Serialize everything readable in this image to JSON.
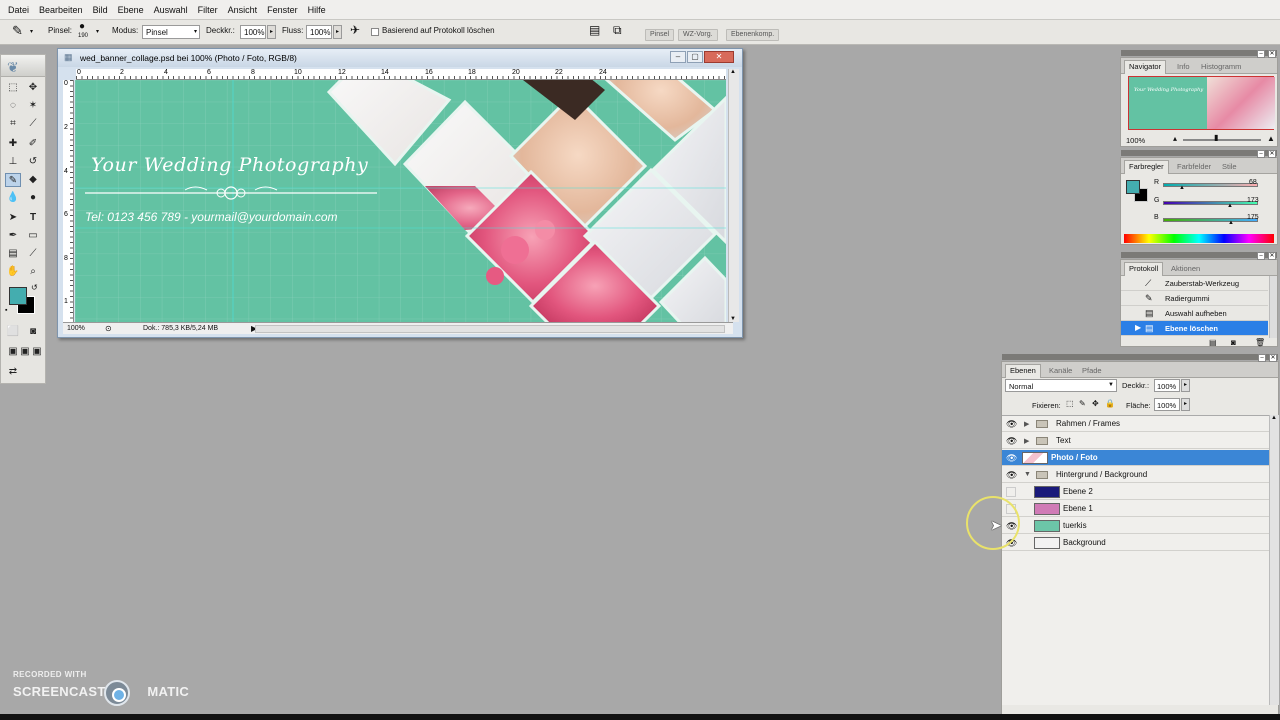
{
  "menu": [
    "Datei",
    "Bearbeiten",
    "Bild",
    "Ebene",
    "Auswahl",
    "Filter",
    "Ansicht",
    "Fenster",
    "Hilfe"
  ],
  "options": {
    "brush_label": "Pinsel:",
    "brush_size": "190",
    "mode_label": "Modus:",
    "mode_value": "Pinsel",
    "opacity_label": "Deckkr.:",
    "opacity_value": "100%",
    "flow_label": "Fluss:",
    "flow_value": "100%",
    "protocol_checkbox": "Basierend auf Protokoll löschen",
    "ws_buttons": [
      "Pinsel",
      "WZ-Vorg.",
      "Ebenenkomp."
    ]
  },
  "document": {
    "title": "wed_banner_collage.psd bei 100% (Photo / Foto, RGB/8)",
    "zoom": "100%",
    "doc_info": "Dok.: 785,3 KB/5,24 MB",
    "ruler_h": [
      "0",
      "2",
      "4",
      "6",
      "8",
      "10",
      "12",
      "14",
      "16",
      "18",
      "20",
      "22",
      "24"
    ],
    "ruler_v": [
      "0",
      "2",
      "4",
      "6",
      "8",
      "1"
    ],
    "banner_title": "Your Wedding Photography",
    "banner_contact": "Tel: 0123 456 789 - yourmail@yourdomain.com"
  },
  "navigator": {
    "tabs": [
      "Navigator",
      "Info",
      "Histogramm"
    ],
    "zoom": "100%",
    "thumb_text": "Your Wedding Photography"
  },
  "color": {
    "tabs": [
      "Farbregler",
      "Farbfelder",
      "Stile"
    ],
    "r_label": "R",
    "r_value": "68",
    "g_label": "G",
    "g_value": "173",
    "b_label": "B",
    "b_value": "175",
    "fg_color": "#44adaf"
  },
  "history": {
    "tabs": [
      "Protokoll",
      "Aktionen"
    ],
    "items": [
      "Zauberstab-Werkzeug",
      "Radiergummi",
      "Auswahl aufheben",
      "Ebene löschen"
    ]
  },
  "layers": {
    "tabs": [
      "Ebenen",
      "Kanäle",
      "Pfade"
    ],
    "blend_mode": "Normal",
    "opacity_label": "Deckkr.:",
    "opacity_value": "100%",
    "lock_label": "Fixieren:",
    "fill_label": "Fläche:",
    "fill_value": "100%",
    "rows": [
      {
        "name": "Rahmen / Frames",
        "kind": "group",
        "visible": true,
        "color": ""
      },
      {
        "name": "Text",
        "kind": "group",
        "visible": true,
        "color": ""
      },
      {
        "name": "Photo / Foto",
        "kind": "layer",
        "visible": true,
        "color": "#f4c2cf"
      },
      {
        "name": "Hintergrund / Background",
        "kind": "group-open",
        "visible": true,
        "color": ""
      },
      {
        "name": "Ebene 2",
        "kind": "child",
        "visible": false,
        "color": "#1a1a7a"
      },
      {
        "name": "Ebene 1",
        "kind": "child",
        "visible": false,
        "color": "#d07bb6"
      },
      {
        "name": "tuerkis",
        "kind": "child",
        "visible": true,
        "color": "#6cc6a8"
      },
      {
        "name": "Background",
        "kind": "child",
        "visible": true,
        "color": "#f2f2f2"
      }
    ]
  },
  "watermark": {
    "top": "RECORDED WITH",
    "brand_left": "SCREENCAST",
    "brand_right": "MATIC"
  }
}
